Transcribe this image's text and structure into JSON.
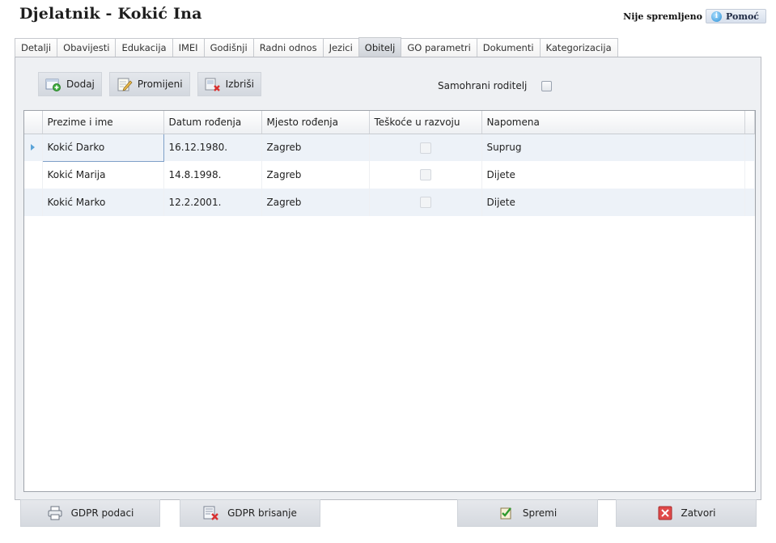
{
  "header": {
    "title": "Djelatnik - Kokić Ina",
    "status": "Nije spremljeno",
    "help_label": "Pomoć",
    "help_icon": "info-icon"
  },
  "tabs": [
    {
      "label": "Detalji"
    },
    {
      "label": "Obavijesti"
    },
    {
      "label": "Edukacija"
    },
    {
      "label": "IMEI"
    },
    {
      "label": "Godišnji"
    },
    {
      "label": "Radni odnos"
    },
    {
      "label": "Jezici"
    },
    {
      "label": "Obitelj",
      "active": true
    },
    {
      "label": "GO parametri"
    },
    {
      "label": "Dokumenti"
    },
    {
      "label": "Kategorizacija"
    }
  ],
  "toolbar": {
    "add_label": "Dodaj",
    "edit_label": "Promijeni",
    "delete_label": "Izbriši",
    "single_parent_label": "Samohrani roditelj",
    "single_parent_checked": false
  },
  "grid": {
    "columns": [
      "Prezime i ime",
      "Datum rođenja",
      "Mjesto rođenja",
      "Teškoće u razvoju",
      "Napomena"
    ],
    "rows": [
      {
        "name": "Kokić Darko",
        "dob": "16.12.1980.",
        "place": "Zagreb",
        "difficulties": false,
        "note": "Suprug"
      },
      {
        "name": "Kokić Marija",
        "dob": "14.8.1998.",
        "place": "Zagreb",
        "difficulties": false,
        "note": "Dijete"
      },
      {
        "name": "Kokić Marko",
        "dob": "12.2.2001.",
        "place": "Zagreb",
        "difficulties": false,
        "note": "Dijete"
      }
    ]
  },
  "footer": {
    "gdpr_data_label": "GDPR podaci",
    "gdpr_delete_label": "GDPR brisanje",
    "save_label": "Spremi",
    "close_label": "Zatvori"
  },
  "colors": {
    "accent": "#5aa3d8",
    "close_red": "#e04a4a",
    "row_alt": "#edf2f8"
  }
}
